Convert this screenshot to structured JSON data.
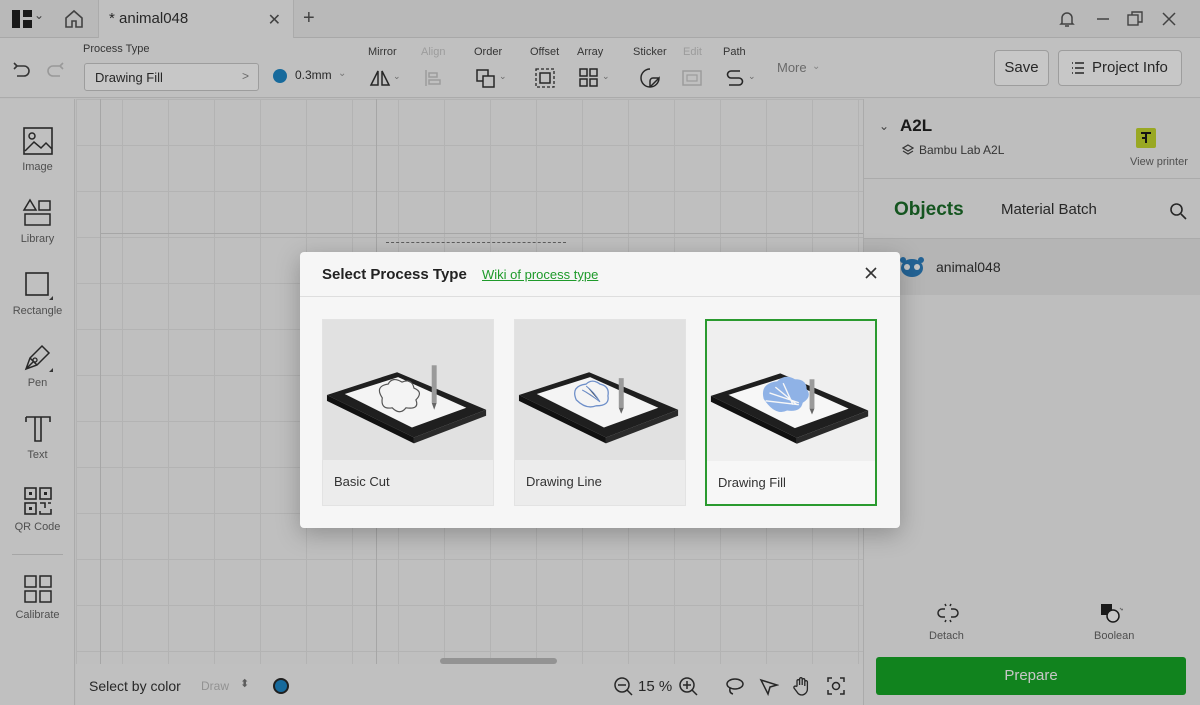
{
  "titlebar": {
    "doc_title": "* animal048"
  },
  "toolbar": {
    "process_type_label": "Process Type",
    "process_type_value": "Drawing Fill",
    "pen_size": "0.3mm",
    "tools": [
      {
        "label": "Mirror"
      },
      {
        "label": "Align"
      },
      {
        "label": "Order"
      },
      {
        "label": "Offset"
      },
      {
        "label": "Array"
      },
      {
        "label": "Sticker"
      },
      {
        "label": "Edit"
      },
      {
        "label": "Path"
      }
    ],
    "more_label": "More",
    "save_label": "Save",
    "project_info_label": "Project Info",
    "pen_color": "#1e88c8"
  },
  "sidebar": {
    "items": [
      {
        "label": "Image"
      },
      {
        "label": "Library"
      },
      {
        "label": "Rectangle"
      },
      {
        "label": "Pen"
      },
      {
        "label": "Text"
      },
      {
        "label": "QR Code"
      },
      {
        "label": "Calibrate"
      }
    ]
  },
  "canvas_bottom": {
    "select_by_color": "Select by color",
    "draw_select": "Draw",
    "zoom": "15 %"
  },
  "right_panel": {
    "printer_name": "A2L",
    "printer_model": "Bambu Lab A2L",
    "view_printer": "View printer",
    "tab_objects": "Objects",
    "tab_material_batch": "Material Batch",
    "objects": [
      {
        "name": "animal048"
      }
    ],
    "detach_label": "Detach",
    "boolean_label": "Boolean",
    "prepare_label": "Prepare",
    "accent": "#17a827"
  },
  "modal": {
    "title": "Select Process Type",
    "wiki_link": "Wiki of process type",
    "options": [
      {
        "label": "Basic Cut",
        "selected": false
      },
      {
        "label": "Drawing Line",
        "selected": false
      },
      {
        "label": "Drawing Fill",
        "selected": true
      }
    ]
  }
}
